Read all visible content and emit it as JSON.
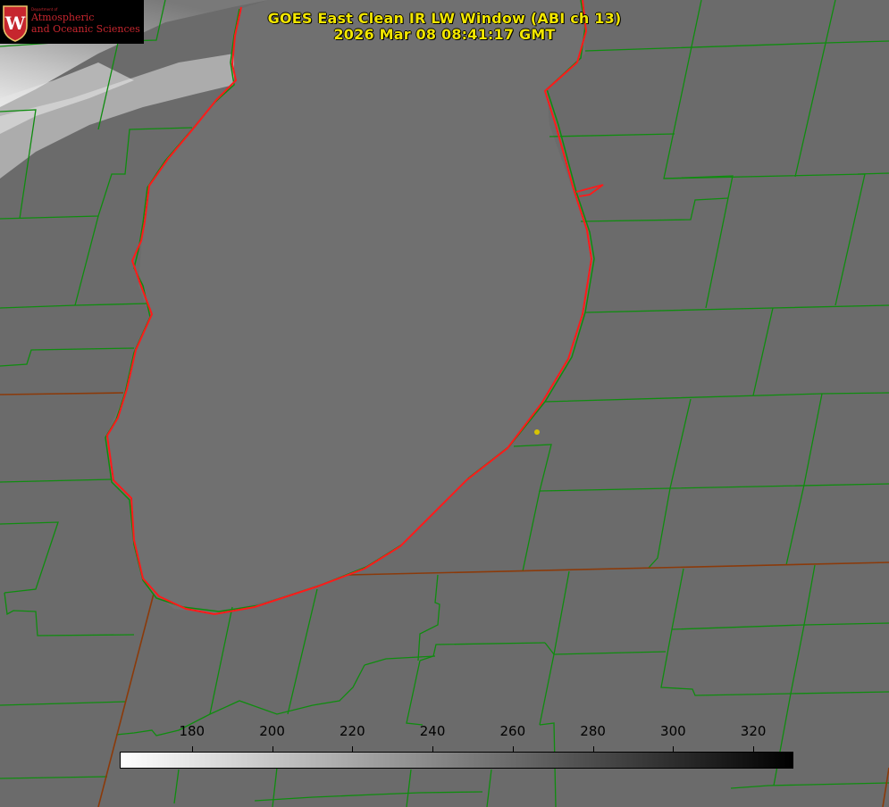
{
  "title": {
    "line1": "GOES East Clean IR LW Window (ABI ch 13)",
    "line2": "2026 Mar 08 08:41:17 GMT"
  },
  "logo": {
    "small_text": "Department of",
    "line1": "Atmospheric",
    "line2": "and Oceanic Sciences",
    "seal_letter": "W",
    "color": "#c6262e"
  },
  "colorbar": {
    "min": 162,
    "max": 330,
    "ticks": [
      "180",
      "200",
      "220",
      "240",
      "260",
      "280",
      "300",
      "320"
    ],
    "cmap": "white-to-black"
  },
  "colors": {
    "background": "#6a6a6a",
    "county_lines": "#0f8c0f",
    "state_lines": "#8b3a0a",
    "coastline": "#ff1a1a",
    "title_text": "#f2e600",
    "marker": "#d8c400"
  },
  "map": {
    "features": [
      "lake-michigan-coastline",
      "county-boundaries",
      "state-boundaries",
      "city-marker"
    ]
  }
}
